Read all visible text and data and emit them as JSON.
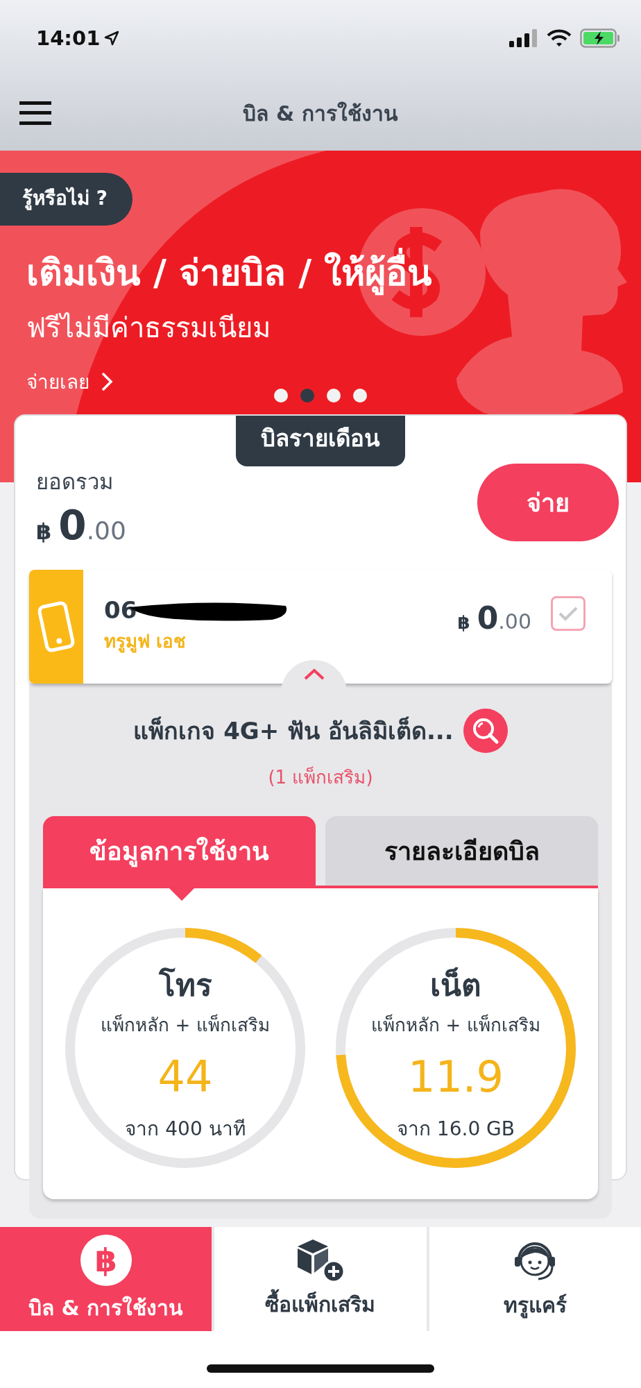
{
  "status_bar": {
    "time": "14:01"
  },
  "header": {
    "title": "บิล & การใช้งาน"
  },
  "banner": {
    "badge": "รู้หรือไม่ ?",
    "headline": "เติมเงิน / จ่ายบิล / ให้ผู้อื่น",
    "subline": "ฟรีไม่มีค่าธรรมเนียม",
    "link": "จ่ายเลย",
    "dots": [
      {
        "selected": false
      },
      {
        "selected": true
      },
      {
        "selected": false
      },
      {
        "selected": false
      }
    ]
  },
  "bill": {
    "tab_label": "บิลรายเดือน",
    "total_label": "ยอดรวม",
    "currency": "฿",
    "amount_whole": "0",
    "amount_decimal": ".00",
    "pay_button": "จ่าย"
  },
  "line": {
    "number": "06",
    "plan": "ทรูมูฟ เอช",
    "currency": "฿",
    "amount_whole": "0",
    "amount_decimal": ".00",
    "checked": true
  },
  "package": {
    "name": "แพ็กเกจ 4G+ ฟัน อันลิมิเต็ด...",
    "addons": "(1 แพ็กเสริม)"
  },
  "tabs": [
    {
      "label": "ข้อมูลการใช้งาน",
      "selected": true
    },
    {
      "label": "รายละเอียดบิล",
      "selected": false
    }
  ],
  "meters": [
    {
      "title": "โทร",
      "subtitle": "แพ็กหลัก + แพ็กเสริม",
      "value": "44",
      "total": "จาก 400 นาที"
    },
    {
      "title": "เน็ต",
      "subtitle": "แพ็กหลัก + แพ็กเสริม",
      "value": "11.9",
      "total": "จาก 16.0 GB"
    }
  ],
  "nav": [
    {
      "label": "บิล & การใช้งาน",
      "selected": true,
      "kind": "bill",
      "icon": "฿"
    },
    {
      "label": "ซื้อแพ็กเสริม",
      "selected": false,
      "kind": "addon"
    },
    {
      "label": "ทรูแคร์",
      "selected": false,
      "kind": "care"
    }
  ]
}
